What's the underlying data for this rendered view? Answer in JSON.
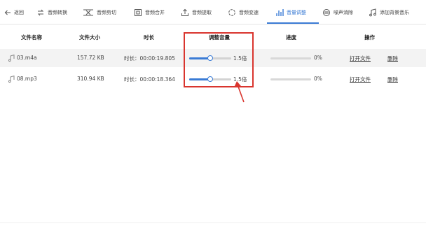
{
  "toolbar": {
    "items": [
      {
        "label": "返回",
        "icon": "back-arrow-icon"
      },
      {
        "label": "音频转换",
        "icon": "convert-icon"
      },
      {
        "label": "音频剪切",
        "icon": "cut-icon"
      },
      {
        "label": "音频合并",
        "icon": "merge-icon"
      },
      {
        "label": "音频提取",
        "icon": "extract-icon"
      },
      {
        "label": "音频变速",
        "icon": "speed-icon"
      },
      {
        "label": "音量调整",
        "icon": "volume-bars-icon"
      },
      {
        "label": "噪声消除",
        "icon": "noise-icon"
      },
      {
        "label": "添加背景音乐",
        "icon": "music-icon"
      }
    ],
    "active_index": 6,
    "accent": "#3a7bd5"
  },
  "table": {
    "headers": {
      "name": "文件名称",
      "size": "文件大小",
      "duration": "时长",
      "volume": "调整音量",
      "progress": "进度",
      "actions": "操作"
    },
    "rows": [
      {
        "name": "03.m4a",
        "size": "157.72 KB",
        "duration_prefix": "时长：",
        "duration": "00:00:19.805",
        "volume_value": 0.5,
        "volume_label": "1.5倍",
        "progress_label": "0%",
        "progress_value": 0,
        "open_label": "打开文件",
        "delete_label": "删除"
      },
      {
        "name": "08.mp3",
        "size": "310.94 KB",
        "duration_prefix": "时长：",
        "duration": "00:00:18.364",
        "volume_value": 0.5,
        "volume_label": "1.5倍",
        "progress_label": "0%",
        "progress_value": 0,
        "open_label": "打开文件",
        "delete_label": "删除"
      }
    ]
  },
  "annotation": {
    "color": "#d9352e"
  }
}
